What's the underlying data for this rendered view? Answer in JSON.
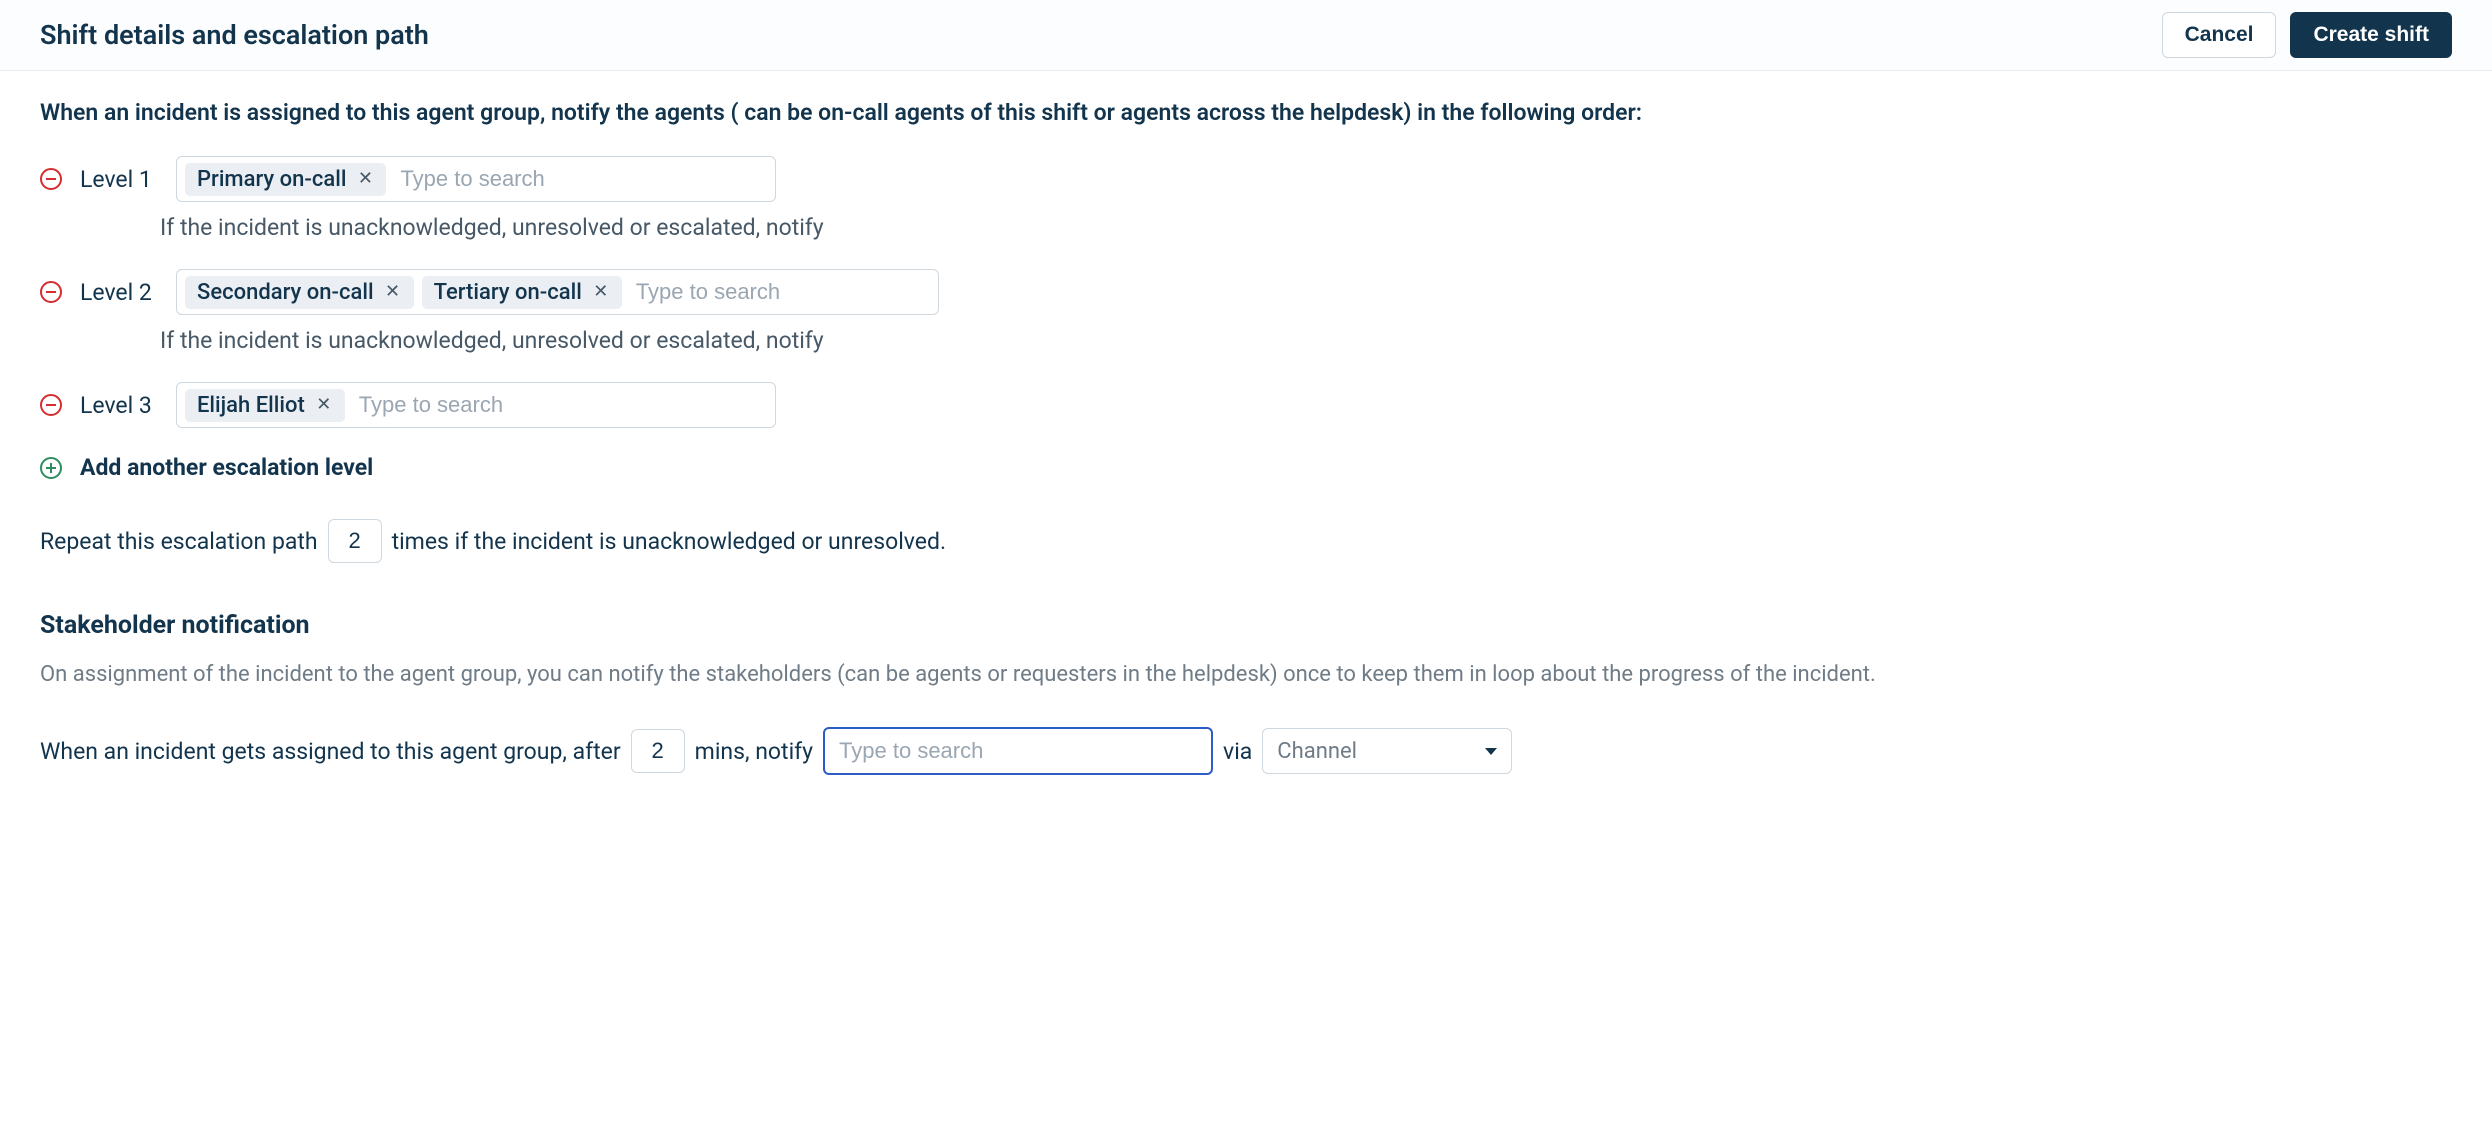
{
  "header": {
    "title": "Shift details and escalation path",
    "cancel_label": "Cancel",
    "create_label": "Create shift"
  },
  "intro": "When an incident is assigned to this agent group, notify the agents ( can be on-call agents of this shift or agents across the helpdesk) in the following order:",
  "placeholder": "Type to search",
  "hint_text": "If the incident is unacknowledged, unresolved or escalated, notify",
  "levels": [
    {
      "label": "Level 1",
      "tags": [
        "Primary on-call"
      ],
      "show_hint": true
    },
    {
      "label": "Level 2",
      "tags": [
        "Secondary on-call",
        "Tertiary on-call"
      ],
      "show_hint": true
    },
    {
      "label": "Level 3",
      "tags": [
        "Elijah Elliot"
      ],
      "show_hint": false
    }
  ],
  "add_level_label": "Add another escalation level",
  "repeat": {
    "prefix": "Repeat this escalation path",
    "value": "2",
    "suffix": "times if the incident is unacknowledged or unresolved."
  },
  "stakeholder": {
    "heading": "Stakeholder notification",
    "description": "On assignment of the incident to the agent group, you can notify the stakeholders (can be agents or requesters in the helpdesk) once to keep them in loop about the progress of the incident.",
    "line_prefix": "When an incident gets assigned to this agent group, after",
    "minutes_value": "2",
    "mins_notify_label": "mins, notify",
    "via_label": "via",
    "channel_placeholder": "Channel"
  }
}
